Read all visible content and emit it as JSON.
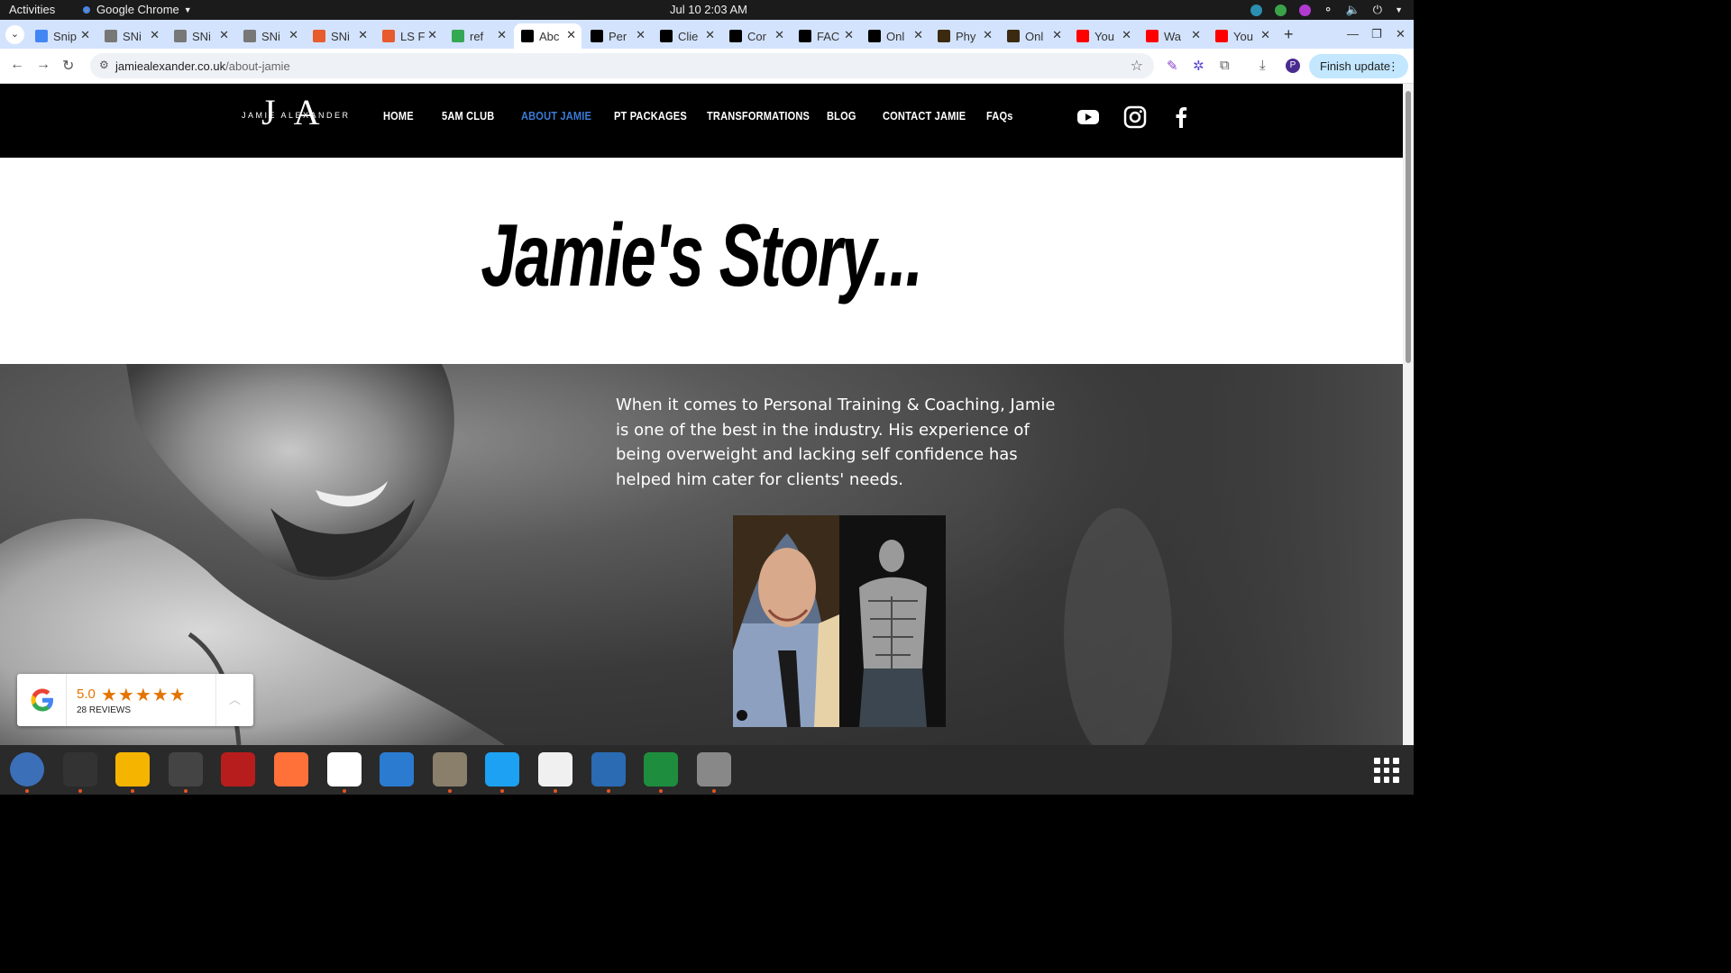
{
  "system_bar": {
    "activities": "Activities",
    "app_name": "Google Chrome",
    "clock": "Jul 10  2:03 AM"
  },
  "tabs": [
    {
      "title": "Snip",
      "color": "#4285f4"
    },
    {
      "title": "SNi",
      "color": "#777777"
    },
    {
      "title": "SNi",
      "color": "#777777"
    },
    {
      "title": "SNi",
      "color": "#777777"
    },
    {
      "title": "SNi",
      "color": "#e85b2c"
    },
    {
      "title": "LS F",
      "color": "#e85b2c"
    },
    {
      "title": "ref",
      "color": "#34a853"
    },
    {
      "title": "Abc",
      "color": "#000000"
    },
    {
      "title": "Per",
      "color": "#000000"
    },
    {
      "title": "Clie",
      "color": "#000000"
    },
    {
      "title": "Cor",
      "color": "#000000"
    },
    {
      "title": "FAC",
      "color": "#000000"
    },
    {
      "title": "Onl",
      "color": "#000000"
    },
    {
      "title": "Phy",
      "color": "#3b2a10"
    },
    {
      "title": "Onl",
      "color": "#3b2a10"
    },
    {
      "title": "You",
      "color": "#ff0000"
    },
    {
      "title": "Wa",
      "color": "#ff0000"
    },
    {
      "title": "You",
      "color": "#ff0000"
    }
  ],
  "active_tab_index": 7,
  "address_bar": {
    "domain": "jamiealexander.co.uk",
    "path": "/about-jamie"
  },
  "toolbar": {
    "finish_update": "Finish update",
    "avatar_letter": "P"
  },
  "site": {
    "logo_letters": "JA",
    "logo_name": "JAMIE ALEXANDER",
    "nav": [
      "HOME",
      "5AM CLUB",
      "ABOUT JAMIE",
      "PT PACKAGES",
      "TRANSFORMATIONS",
      "BLOG",
      "CONTACT JAMIE",
      "FAQs"
    ],
    "active_nav": "ABOUT JAMIE",
    "hero_title": "Jamie's Story...",
    "story_text": "When it comes to Personal Training & Coaching, Jamie is one of the best in the industry. His experience of being overweight and lacking self confidence has helped him cater for clients' needs."
  },
  "reviews_widget": {
    "score": "5.0",
    "stars": "★★★★★",
    "count": "28 REVIEWS"
  },
  "colors": {
    "active_nav": "#3a7bd5",
    "tabstrip": "#d3e3fd",
    "finish_update_bg": "#c2e7ff",
    "review_orange": "#e37400"
  },
  "dock_apps": [
    "thunderbird-icon",
    "terminal-icon",
    "calculator-icon",
    "system-monitor-icon",
    "filezilla-icon",
    "firefox-icon",
    "chrome-icon",
    "vscode-icon",
    "files-icon",
    "skype-icon",
    "text-editor-icon",
    "writer-icon",
    "calc-icon",
    "disk-icon"
  ]
}
